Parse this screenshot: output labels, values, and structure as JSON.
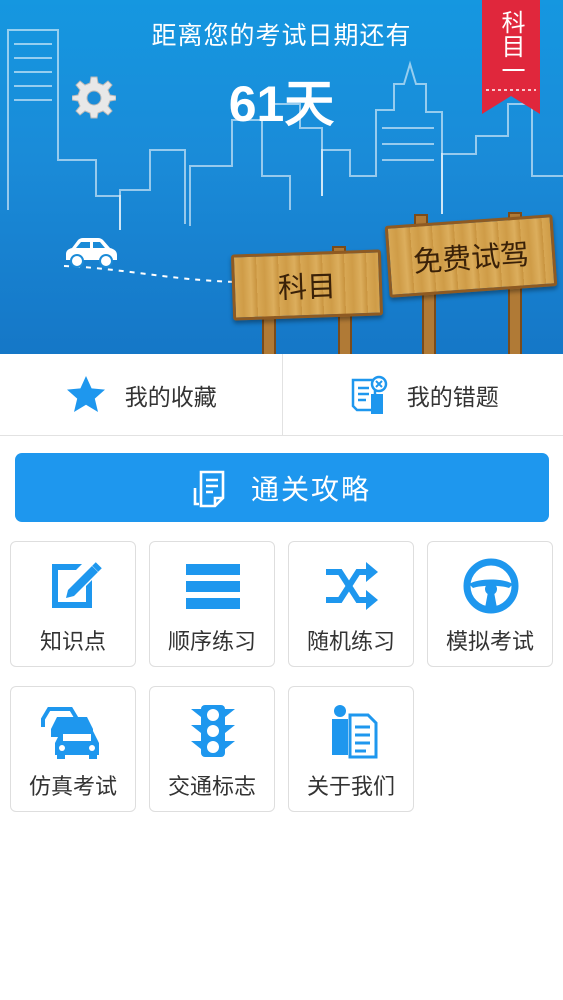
{
  "banner": {
    "countdown_title": "距离您的考试日期还有",
    "countdown_days": "61天",
    "subject_badge": "科目一",
    "sign_left": "科目",
    "sign_right": "免费试驾",
    "settings_icon": "gear-icon",
    "car_icon": "car-icon",
    "colors": {
      "sky": "#1597e0",
      "ribbon": "#e0273c",
      "wood": "#d8a855"
    }
  },
  "quick": {
    "favorites": {
      "label": "我的收藏",
      "icon": "star-icon"
    },
    "mistakes": {
      "label": "我的错题",
      "icon": "wrong-answers-icon"
    }
  },
  "strategy": {
    "label": "通关攻略",
    "icon": "document-icon",
    "color": "#1e97ee"
  },
  "grid": {
    "accent": "#1e97ee",
    "items": [
      {
        "label": "知识点",
        "icon": "edit-icon"
      },
      {
        "label": "顺序练习",
        "icon": "list-icon"
      },
      {
        "label": "随机练习",
        "icon": "shuffle-icon"
      },
      {
        "label": "模拟考试",
        "icon": "steering-wheel-icon"
      },
      {
        "label": "仿真考试",
        "icon": "cars-icon"
      },
      {
        "label": "交通标志",
        "icon": "traffic-light-icon"
      },
      {
        "label": "关于我们",
        "icon": "about-icon"
      }
    ]
  }
}
